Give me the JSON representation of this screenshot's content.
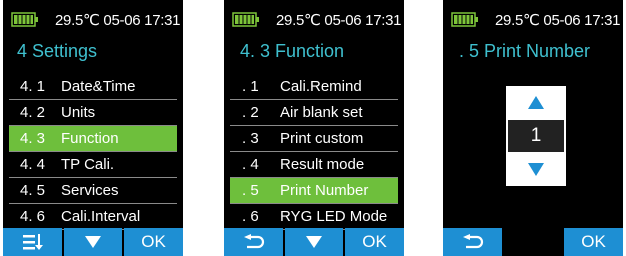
{
  "status": {
    "temperature": "29.5℃",
    "date": "05-06",
    "time": "17:31"
  },
  "colors": {
    "accent_title": "#3fc0cf",
    "selection": "#6ebf3c",
    "softkey": "#1e8fd3",
    "battery": "#7ec53a"
  },
  "screen1": {
    "title": "4 Settings",
    "items": [
      {
        "num": "4. 1",
        "label": "Date&Time"
      },
      {
        "num": "4. 2",
        "label": "Units"
      },
      {
        "num": "4. 3",
        "label": "Function",
        "selected": true
      },
      {
        "num": "TP Cali.",
        "label": ""
      },
      {
        "num": "4. 5",
        "label": "Services"
      },
      {
        "num": "4. 6",
        "label": "Cali.Interval"
      }
    ],
    "softkeys": {
      "left_icon": "menu-down-icon",
      "middle_icon": "down-triangle-icon",
      "right": "OK"
    }
  },
  "screen2": {
    "title": "4. 3  Function",
    "items": [
      {
        "num": ". 1",
        "label": "Cali.Remind"
      },
      {
        "num": ". 2",
        "label": "Air blank set"
      },
      {
        "num": ". 3",
        "label": "Print custom"
      },
      {
        "num": ". 4",
        "label": "Result mode"
      },
      {
        "num": ". 5",
        "label": "Print Number",
        "selected": true
      },
      {
        "num": ". 6",
        "label": "RYG LED Mode"
      }
    ],
    "softkeys": {
      "left_icon": "back-arrow-icon",
      "middle_icon": "down-triangle-icon",
      "right": "OK"
    }
  },
  "screen3": {
    "title": ". 5 Print Number",
    "value": "1",
    "softkeys": {
      "left_icon": "back-arrow-icon",
      "right": "OK"
    }
  }
}
